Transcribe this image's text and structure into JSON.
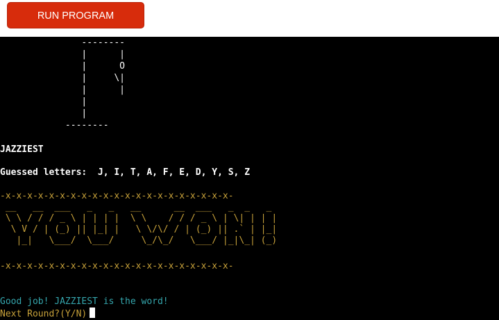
{
  "toolbar": {
    "run_label": "RUN PROGRAM",
    "accent_color": "#d72c0c"
  },
  "terminal": {
    "gallows_art": "               --------\n               |      |\n               |      O\n               |     \\|\n               |      |\n               |\n               |\n            --------",
    "word": "JAZZIEST",
    "guessed_line": "Guessed letters:  J, I, T, A, F, E, D, Y, S, Z",
    "divider": "-x-x-x-x-x-x-x-x-x-x-x-x-x-x-x-x-x-x-x-x-x-",
    "banner_art": " __   __  ___   _   _   __      __  ___   _  _   _ \n \\ \\ / / / _ \\ | | | |  \\ \\    / / / _ \\ | \\| | | |\n  \\ V / | (_) || |_| |   \\ \\/\\/ / | (_) || .` | |_|\n   |_|   \\___/  \\___/     \\_/\\_/   \\___/ |_|\\_| (_)",
    "message": "Good job! JAZZIEST is the word!",
    "prompt": "Next Round?(Y/N)",
    "colors": {
      "text": "#ffffff",
      "banner": "#c8a23a",
      "message": "#35a7ae"
    }
  }
}
